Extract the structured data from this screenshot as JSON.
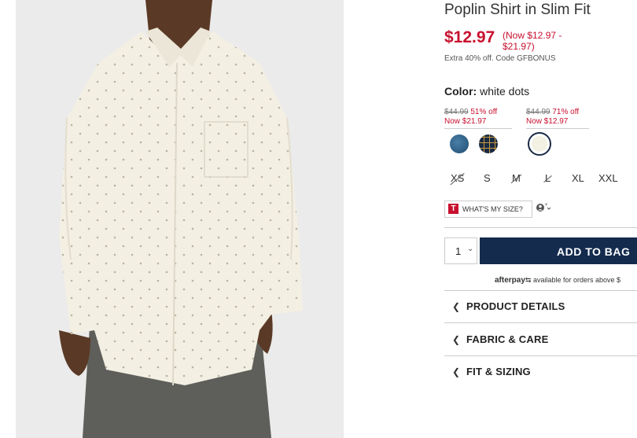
{
  "product": {
    "title": "Poplin Shirt in Slim Fit",
    "price": "$12.97",
    "price_range": "(Now $12.97 - $21.97)",
    "promo": "Extra 40% off. Code GFBONUS"
  },
  "color": {
    "label": "Color:",
    "value": "white dots"
  },
  "swatch_groups": [
    {
      "was": "$44.99",
      "off": "51% off",
      "now": "Now $21.97"
    },
    {
      "was": "$44.99",
      "off": "71% off",
      "now": "Now $12.97"
    }
  ],
  "swatches": [
    {
      "name": "blue",
      "color": "#2e5f85"
    },
    {
      "name": "navy plaid",
      "color": "#1a2a45"
    },
    {
      "name": "white dots",
      "color": "#f3f0e4",
      "selected": true
    }
  ],
  "sizes": [
    {
      "label": "XS",
      "available": false
    },
    {
      "label": "S",
      "available": true
    },
    {
      "label": "M",
      "available": false
    },
    {
      "label": "L",
      "available": false
    },
    {
      "label": "XL",
      "available": true
    },
    {
      "label": "XXL",
      "available": true
    }
  ],
  "fit": {
    "logo": "T",
    "label": "WHAT'S MY SIZE?"
  },
  "cart": {
    "quantity": "1",
    "add_label": "ADD TO BAG"
  },
  "afterpay": {
    "brand": "afterpay",
    "text": "available for orders above $"
  },
  "accordion": [
    {
      "label": "PRODUCT DETAILS"
    },
    {
      "label": "FABRIC & CARE"
    },
    {
      "label": "FIT & SIZING"
    }
  ],
  "colors": {
    "accent": "#c8102e",
    "button": "#142b4e"
  }
}
